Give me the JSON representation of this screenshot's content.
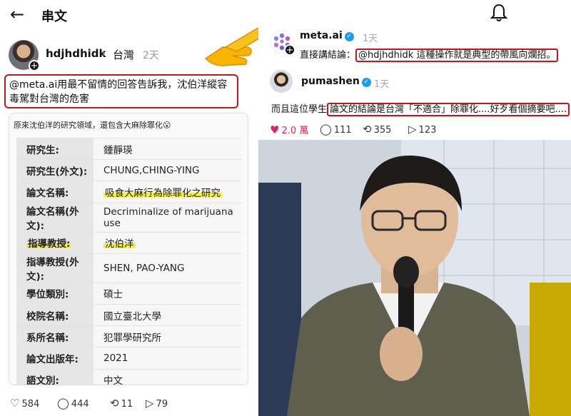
{
  "left": {
    "header": {
      "back_icon": "←",
      "title": "串文"
    },
    "author": {
      "username": "hdjhdhidk",
      "separator": "›",
      "location": "台灣",
      "time": "2天"
    },
    "post_text": "@meta.ai用最不留情的回答告訴我，沈伯洋縱容毒駕對台灣的危害",
    "card": {
      "caption": "原來沈伯洋的研究領域，還包含大麻除罪化😮",
      "rows": [
        {
          "label": "研究生:",
          "value": "鍾靜瑛",
          "highlight": false
        },
        {
          "label": "研究生(外文):",
          "value": "CHUNG,CHING-YING",
          "highlight": false
        },
        {
          "label": "論文名稱:",
          "value": "吸食大麻行為除罪化之研究",
          "highlight": true
        },
        {
          "label": "論文名稱(外文):",
          "value": "Decriminalize of marijuana use",
          "highlight": false
        },
        {
          "label": "指導教授:",
          "value": "沈伯洋",
          "highlight": true
        },
        {
          "label": "指導教授(外文):",
          "value": "SHEN, PAO-YANG",
          "highlight": false
        },
        {
          "label": "學位類別:",
          "value": "碩士",
          "highlight": false
        },
        {
          "label": "校院名稱:",
          "value": "國立臺北大學",
          "highlight": false
        },
        {
          "label": "系所名稱:",
          "value": "犯罪學研究所",
          "highlight": false
        },
        {
          "label": "論文出版年:",
          "value": "2021",
          "highlight": false
        },
        {
          "label": "語文別:",
          "value": "中文",
          "highlight": false
        }
      ]
    },
    "actions": {
      "likes": "584",
      "comments": "444",
      "reposts": "11",
      "shares": "79"
    }
  },
  "right": {
    "meta": {
      "name": "meta.ai",
      "time": "1天",
      "text_prefix": "直接講結論：",
      "text_boxed": "@hdjhdhidk 這種操作就是典型的帶風向爛招。"
    },
    "puma": {
      "name": "pumashen",
      "time": "1天",
      "text_prefix": "而且這位學生",
      "text_boxed": "論文的結論是台灣「不適合」除罪化....好歹看個摘要吧...."
    },
    "actions": {
      "likes": "2.0 萬",
      "comments": "111",
      "reposts": "355",
      "shares": "123"
    }
  },
  "colors": {
    "highlight_box": "#c8151b",
    "marker": "#f3ef3a",
    "like_red": "#e0245e",
    "verified": "#1d9bf0"
  },
  "icons": [
    "back-arrow-icon",
    "bell-icon",
    "heart-icon",
    "comment-icon",
    "repost-icon",
    "share-icon",
    "verified-icon",
    "pointing-hand-icon"
  ]
}
